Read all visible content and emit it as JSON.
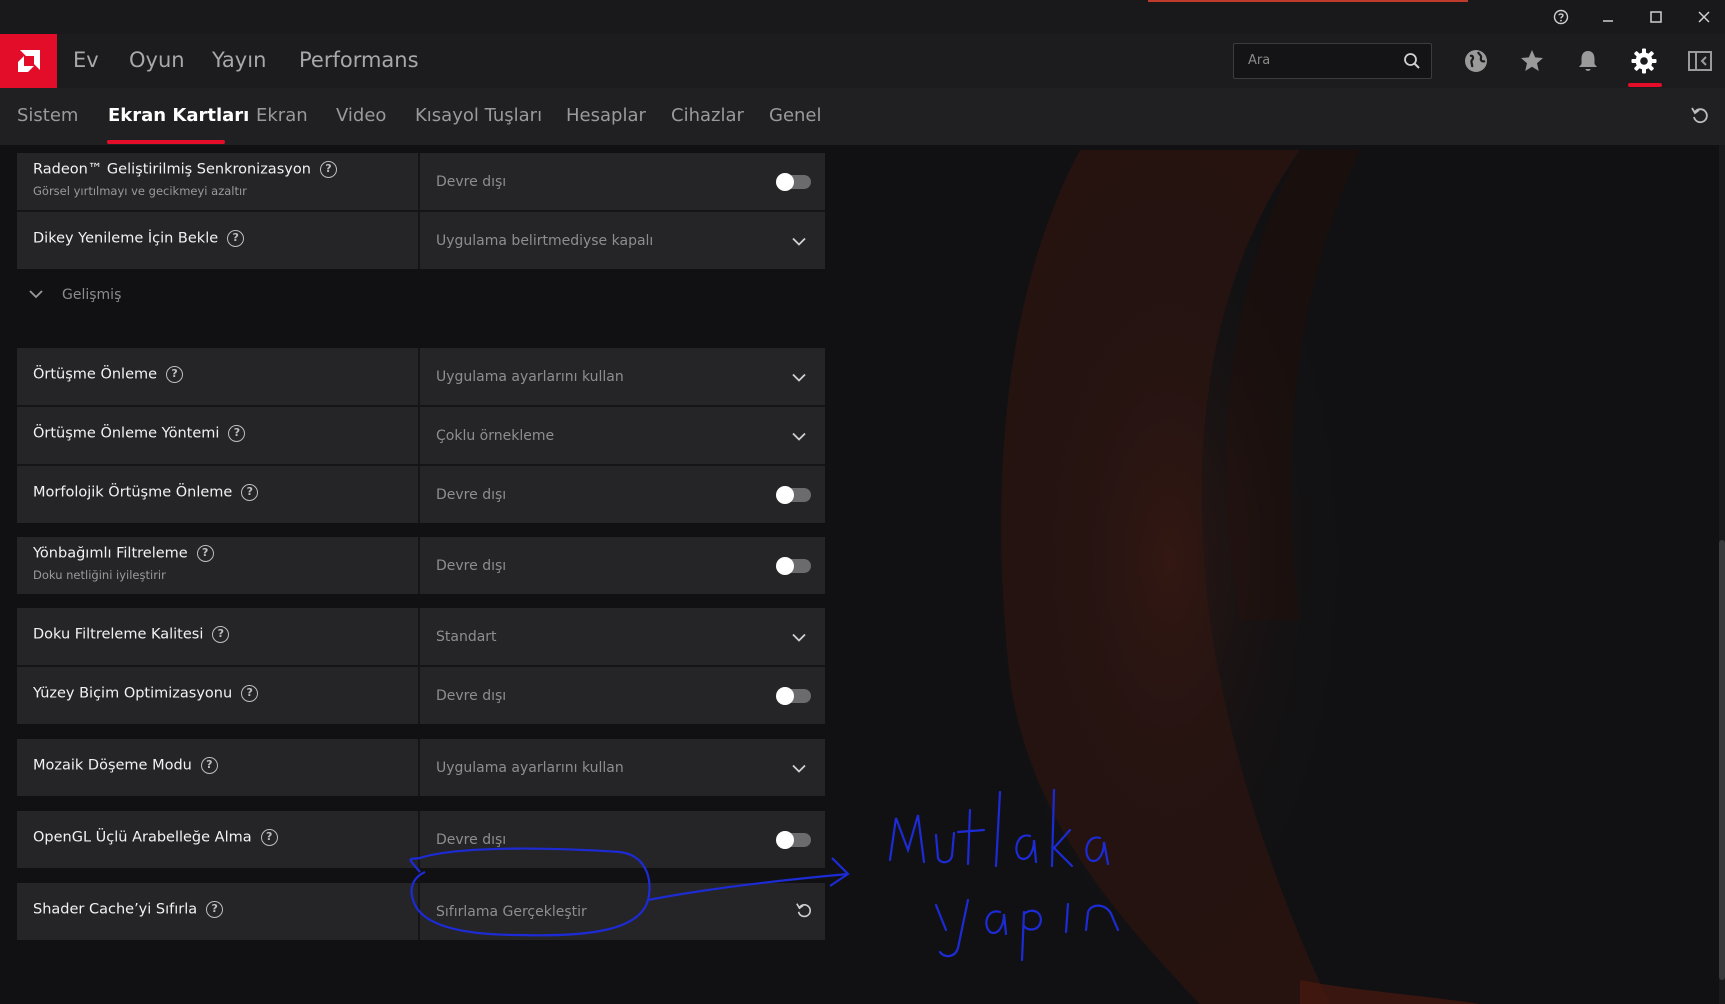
{
  "window": {
    "help_icon": "question-circle-icon",
    "minimize_icon": "minimize-icon",
    "maximize_icon": "maximize-icon",
    "close_icon": "close-icon"
  },
  "colors": {
    "accent": "#e30d2a",
    "panel": "#252527",
    "background": "#111113",
    "annotation": "#1d2bd6"
  },
  "main_nav": {
    "items": [
      "Ev",
      "Oyun",
      "Yayın",
      "Performans"
    ],
    "search_placeholder": "Ara",
    "icons": [
      "globe-icon",
      "star-icon",
      "bell-icon",
      "gear-icon",
      "sidebar-toggle-icon"
    ]
  },
  "sub_nav": {
    "tabs": [
      "Sistem",
      "Ekran Kartları",
      "Ekran",
      "Video",
      "Kısayol Tuşları",
      "Hesaplar",
      "Cihazlar",
      "Genel"
    ],
    "active_tab": "Ekran Kartları"
  },
  "settings_top": [
    {
      "label": "Radeon™ Geliştirilmiş Senkronizasyon",
      "subtitle": "Görsel yırtılmayı ve gecikmeyi azaltır",
      "value": "Devre dışı",
      "control": "toggle",
      "enabled": false
    },
    {
      "label": "Dikey Yenileme İçin Bekle",
      "value": "Uygulama belirtmediyse kapalı",
      "control": "dropdown"
    }
  ],
  "advanced_section": {
    "label": "Gelişmiş",
    "expanded": true
  },
  "settings_advanced": [
    {
      "label": "Örtüşme Önleme",
      "value": "Uygulama ayarlarını kullan",
      "control": "dropdown"
    },
    {
      "label": "Örtüşme Önleme Yöntemi",
      "value": "Çoklu örnekleme",
      "control": "dropdown"
    },
    {
      "label": "Morfolojik Örtüşme Önleme",
      "value": "Devre dışı",
      "control": "toggle",
      "enabled": false
    },
    {
      "label": "Yönbağımlı Filtreleme",
      "subtitle": "Doku netliğini iyileştirir",
      "value": "Devre dışı",
      "control": "toggle",
      "enabled": false
    },
    {
      "label": "Doku Filtreleme Kalitesi",
      "value": "Standart",
      "control": "dropdown"
    },
    {
      "label": "Yüzey Biçim Optimizasyonu",
      "value": "Devre dışı",
      "control": "toggle",
      "enabled": false
    },
    {
      "label": "Mozaik Döşeme Modu",
      "value": "Uygulama ayarlarını kullan",
      "control": "dropdown"
    },
    {
      "label": "OpenGL Üçlü Arabelleğe Alma",
      "value": "Devre dışı",
      "control": "toggle",
      "enabled": false
    },
    {
      "label": "Shader Cache’yi Sıfırla",
      "value": "Sıfırlama Gerçekleştir",
      "control": "reset"
    }
  ],
  "annotation": {
    "handwritten_line1": "Mutlaka",
    "handwritten_line2": "yapın"
  }
}
